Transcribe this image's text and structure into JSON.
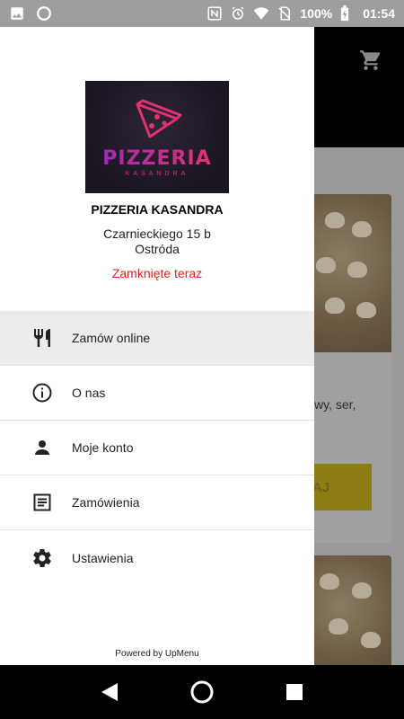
{
  "statusbar": {
    "battery": "100%",
    "time": "01:54",
    "icons": [
      "image-icon",
      "circle-icon",
      "nfc-icon",
      "alarm-icon",
      "wifi-icon",
      "no-sim-icon",
      "battery-charging-icon"
    ]
  },
  "app": {
    "cart_icon": "cart-icon",
    "card_text": "wy, ser,",
    "card_button": "AJ"
  },
  "drawer": {
    "logo": {
      "brand": "PIZZERIA",
      "sub": "KASANDRA"
    },
    "restaurant_name": "PIZZERIA KASANDRA",
    "address_line1": "Czarnieckiego 15 b",
    "address_line2": "Ostróda",
    "status": "Zamknięte teraz",
    "menu": [
      {
        "label": "Zamów online",
        "icon": "fork-knife-icon",
        "active": true
      },
      {
        "label": "O nas",
        "icon": "info-icon",
        "active": false
      },
      {
        "label": "Moje konto",
        "icon": "person-icon",
        "active": false
      },
      {
        "label": "Zamówienia",
        "icon": "list-icon",
        "active": false
      },
      {
        "label": "Ustawienia",
        "icon": "gear-icon",
        "active": false
      }
    ],
    "powered_by": "Powered by UpMenu"
  },
  "colors": {
    "status_closed": "#e02020",
    "active_item_bg": "#ececec"
  }
}
